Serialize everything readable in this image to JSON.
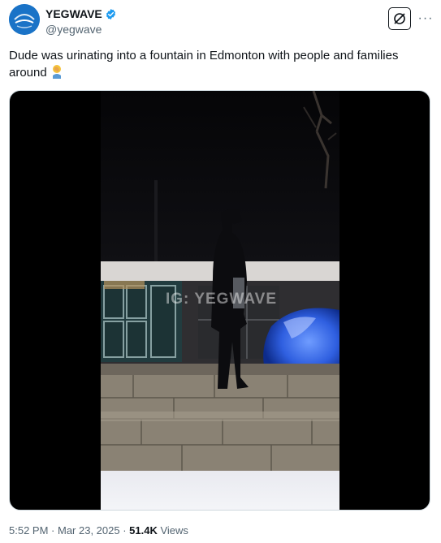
{
  "author": {
    "display_name": "YEGWAVE",
    "handle": "@yegwave",
    "verified": true,
    "avatar_icon": "yegwave-logo"
  },
  "actions": {
    "grok_icon": "grok-icon",
    "more_label": "···"
  },
  "tweet": {
    "text": "Dude was urinating into a fountain in Edmonton with people and families around",
    "emoji": "🤦‍♂️"
  },
  "media": {
    "type": "video",
    "watermark": "IG: YEGWAVE"
  },
  "meta": {
    "time": "5:52 PM",
    "separator1": " · ",
    "date": "Mar 23, 2025",
    "separator2": " · ",
    "views_count": "51.4K",
    "views_label": " Views"
  },
  "colors": {
    "accent": "#1d9bf0",
    "text": "#0f1419",
    "secondary": "#536471"
  }
}
